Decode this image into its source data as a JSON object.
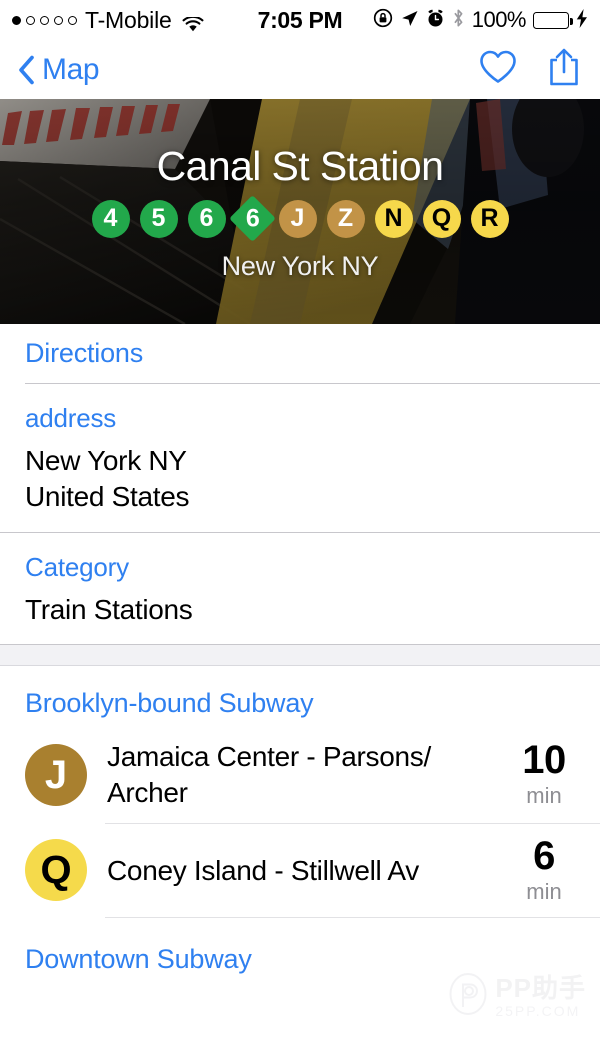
{
  "status_bar": {
    "signal_dots": {
      "total": 5,
      "filled": 1
    },
    "carrier": "T-Mobile",
    "wifi_icon": "wifi-icon",
    "time": "7:05 PM",
    "icons": [
      "rotation-lock-icon",
      "location-arrow-icon",
      "alarm-clock-icon",
      "bluetooth-icon"
    ],
    "battery_percent": "100%",
    "battery_level": 100,
    "battery_color": "#4CD964",
    "charging_icon": "lightning-bolt-icon"
  },
  "nav_bar": {
    "back_icon": "chevron-left-icon",
    "back_label": "Map",
    "favorite_icon": "heart-icon",
    "share_icon": "share-icon",
    "accent_color": "#2F80F0"
  },
  "hero": {
    "title": "Canal St Station",
    "subtitle": "New York NY",
    "lines": [
      {
        "label": "4",
        "shape": "circle",
        "bg": "#22A84B",
        "fg": "#ffffff"
      },
      {
        "label": "5",
        "shape": "circle",
        "bg": "#22A84B",
        "fg": "#ffffff"
      },
      {
        "label": "6",
        "shape": "circle",
        "bg": "#22A84B",
        "fg": "#ffffff"
      },
      {
        "label": "6",
        "shape": "diamond",
        "bg": "#22A84B",
        "fg": "#ffffff"
      },
      {
        "label": "J",
        "shape": "circle",
        "bg": "#C29347",
        "fg": "#ffffff"
      },
      {
        "label": "Z",
        "shape": "circle",
        "bg": "#C29347",
        "fg": "#ffffff"
      },
      {
        "label": "N",
        "shape": "circle",
        "bg": "#F6D councils"
      },
      {
        "label": "Q",
        "shape": "circle",
        "bg": "#F6D84B",
        "fg": "#000000"
      },
      {
        "label": "R",
        "shape": "circle",
        "bg": "#F6D84B",
        "fg": "#000000"
      }
    ]
  },
  "info": {
    "directions_label": "Directions",
    "fields": [
      {
        "label": "address",
        "value": "New York NY\nUnited States"
      },
      {
        "label": "Category",
        "value": "Train Stations"
      }
    ]
  },
  "departures": [
    {
      "header": "Brooklyn-bound Subway",
      "rows": [
        {
          "line": "J",
          "line_bg": "#A9802F",
          "line_fg": "#ffffff",
          "destination": "Jamaica Center - Parsons/ Archer",
          "minutes": "10",
          "unit": "min"
        },
        {
          "line": "Q",
          "line_bg": "#F5DA4B",
          "line_fg": "#000000",
          "destination": "Coney Island - Stillwell Av",
          "minutes": "6",
          "unit": "min"
        }
      ]
    },
    {
      "header": "Downtown Subway",
      "rows": []
    }
  ],
  "watermark": {
    "main": "PP助手",
    "sub": "25PP.COM",
    "logo_icon": "pp-logo-icon"
  }
}
